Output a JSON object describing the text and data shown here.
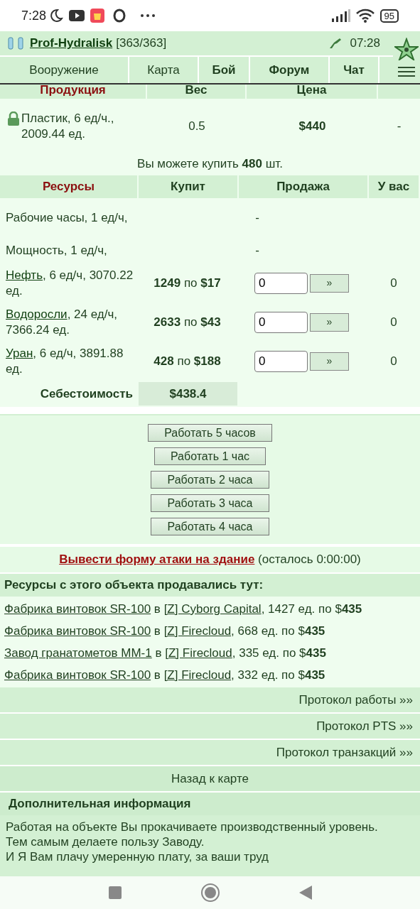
{
  "status_bar": {
    "time": "7:28",
    "battery": "95"
  },
  "header": {
    "player": "Prof-Hydralisk",
    "hp": "[363/363]",
    "clock": "07:28"
  },
  "nav": [
    {
      "label": "Вооружение",
      "bold": false
    },
    {
      "label": "Карта",
      "bold": false
    },
    {
      "label": "Бой",
      "bold": true
    },
    {
      "label": "Форум",
      "bold": true
    },
    {
      "label": "Чат",
      "bold": true
    }
  ],
  "product_table": {
    "columns": [
      "Продукция",
      "Вес",
      "Цена"
    ],
    "rows": [
      {
        "locked": true,
        "name": "Пластик, 6 ед/ч., 2009.44 ед.",
        "weight": "0.5",
        "price": "$440",
        "column_4": "-"
      }
    ]
  },
  "buy_note": "Вы можете купить **480** шт.",
  "resources_table": {
    "columns": [
      "Ресурсы",
      "Купит",
      "Продажа",
      "У вас"
    ],
    "rows": [
      {
        "kind": "plain",
        "name": "Рабочие часы, 1 ед/ч,",
        "sale": "-"
      },
      {
        "kind": "plain",
        "name": "Мощность, 1 ед/ч,",
        "sale": "-"
      },
      {
        "kind": "market",
        "link": "Нефть",
        "details": ", 6 ед/ч, 3070.22 ед.",
        "buy": "**1249** по **$17**",
        "value": "0",
        "button": "»",
        "have": "0"
      },
      {
        "kind": "market",
        "link": "Водоросли",
        "details": ", 24 ед/ч, 7366.24 ед.",
        "buy": "**2633** по **$43**",
        "value": "0",
        "button": "»",
        "have": "0"
      },
      {
        "kind": "market",
        "link": "Уран",
        "details": ", 6 ед/ч, 3891.88 ед.",
        "buy": "**428** по **$188**",
        "value": "0",
        "button": "»",
        "have": "0"
      }
    ],
    "cost": {
      "label": "Себестоимость",
      "value": "$438.4"
    }
  },
  "work_buttons": [
    "Работать 5 часов",
    "Работать 1 час",
    "Работать 2 часа",
    "Работать 3 часа",
    "Работать 4 часа"
  ],
  "attack": {
    "link": "Вывести форму атаки на здание",
    "note": "(осталось 0:00:00)"
  },
  "sold": {
    "title": "Ресурсы с этого объекта продавались тут:",
    "items": [
      {
        "building": "Фабрика винтовок SR-100",
        "connector": "в",
        "city": "[Z] Cyborg Capital",
        "rest": ", 1427 ед. по $**435**"
      },
      {
        "building": "Фабрика винтовок SR-100",
        "connector": "в",
        "city": "[Z] Firecloud",
        "rest": ", 668 ед. по $**435**"
      },
      {
        "building": "Завод гранатометов ММ-1",
        "connector": "в",
        "city": "[Z] Firecloud",
        "rest": ", 335 ед. по $**435**"
      },
      {
        "building": "Фабрика винтовок SR-100",
        "connector": "в",
        "city": "[Z] Firecloud",
        "rest": ", 332 ед. по $**435**"
      }
    ]
  },
  "protocols": [
    "Протокол работы »»",
    "Протокол PTS »»",
    "Протокол транзакций »»"
  ],
  "back": "Назад к карте",
  "info": {
    "title": "Дополнительная информация",
    "lines": [
      "Работая на объекте Вы прокачиваете производственный уровень.",
      "Тем самым делаете пользу Заводу.",
      "И Я Вам плачу умеренную плату, за ваши труд"
    ]
  }
}
